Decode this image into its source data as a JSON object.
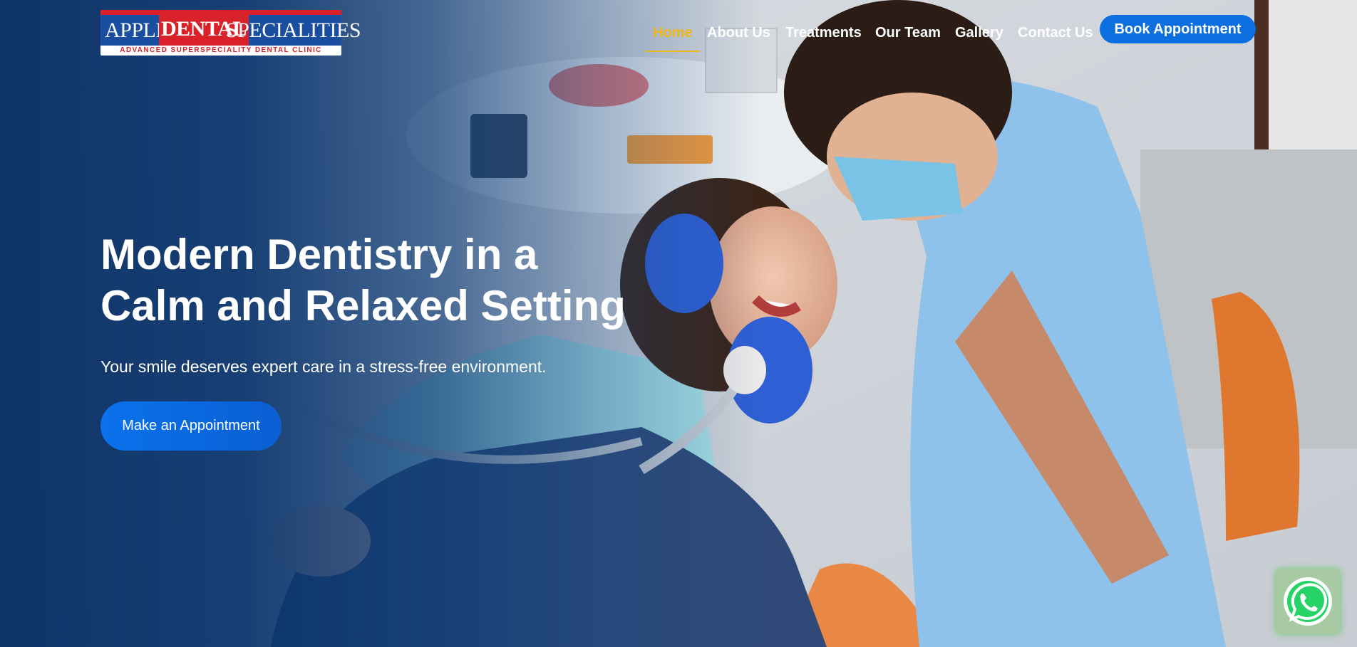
{
  "header": {
    "logo": {
      "words": [
        "APPLE",
        "DENTAL",
        "SPECIALITIES"
      ],
      "tagline": "ADVANCED SUPERSPECIALITY DENTAL CLINIC"
    },
    "nav": [
      {
        "label": "Home",
        "active": true
      },
      {
        "label": "About Us",
        "active": false
      },
      {
        "label": "Treatments",
        "active": false
      },
      {
        "label": "Our Team",
        "active": false
      },
      {
        "label": "Gallery",
        "active": false
      },
      {
        "label": "Contact Us",
        "active": false
      }
    ],
    "book_button": "Book Appointment"
  },
  "hero": {
    "headline_line1": "Modern Dentistry in a",
    "headline_line2": "Calm and Relaxed Setting",
    "subtitle": "Your smile deserves expert care in a stress-free environment.",
    "cta_button": "Make an Appointment"
  },
  "floating": {
    "whatsapp_icon": "whatsapp-icon"
  },
  "colors": {
    "brand_blue": "#0b6fe0",
    "nav_active": "#f2b51a",
    "overlay_navy": "#0b3a72",
    "logo_red": "#d82128",
    "whatsapp_green": "#25d366"
  }
}
